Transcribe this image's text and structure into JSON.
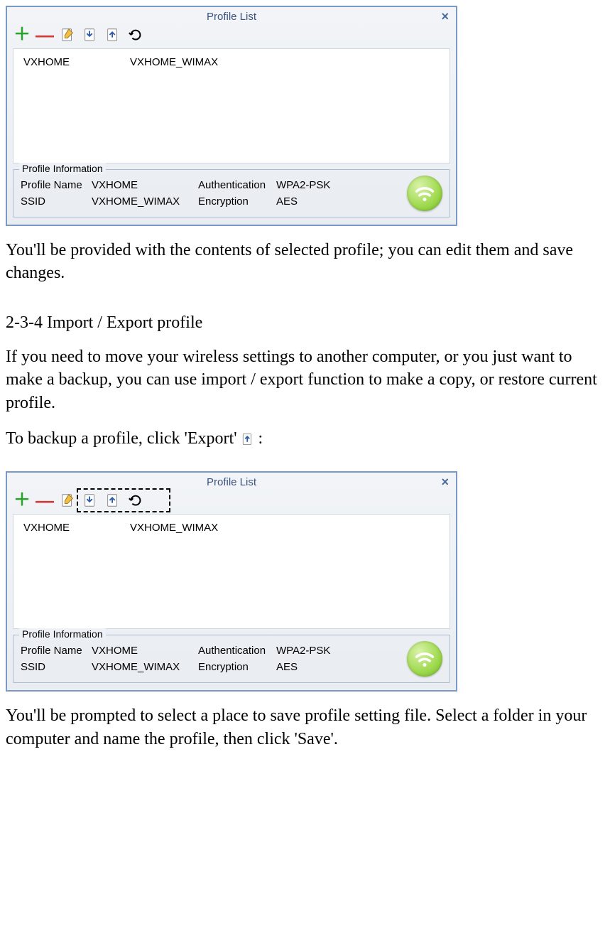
{
  "dialog1": {
    "title": "Profile List",
    "row": {
      "name": "VXHOME",
      "ssid": "VXHOME_WIMAX"
    },
    "info": {
      "legend": "Profile Information",
      "labels": {
        "profile_name": "Profile Name",
        "ssid": "SSID",
        "auth": "Authentication",
        "enc": "Encryption"
      },
      "values": {
        "profile_name": "VXHOME",
        "ssid": "VXHOME_WIMAX",
        "auth": "WPA2-PSK",
        "enc": "AES"
      }
    }
  },
  "paragraph1": "You'll be provided with the contents of selected profile; you can edit them and save changes.",
  "heading": "2-3-4 Import / Export profile",
  "paragraph2": "If you need to move your wireless settings to another computer, or you just want to make a backup, you can use import / export function to make a copy, or restore current profile.",
  "paragraph3_a": "To backup a profile, click 'Export' ",
  "paragraph3_b": ":",
  "dialog2": {
    "title": "Profile List",
    "row": {
      "name": "VXHOME",
      "ssid": "VXHOME_WIMAX"
    },
    "info": {
      "legend": "Profile Information",
      "labels": {
        "profile_name": "Profile Name",
        "ssid": "SSID",
        "auth": "Authentication",
        "enc": "Encryption"
      },
      "values": {
        "profile_name": "VXHOME",
        "ssid": "VXHOME_WIMAX",
        "auth": "WPA2-PSK",
        "enc": "AES"
      }
    }
  },
  "paragraph4": "You'll be prompted to select a place to save profile setting file. Select a folder in your computer and name the profile, then click 'Save'."
}
